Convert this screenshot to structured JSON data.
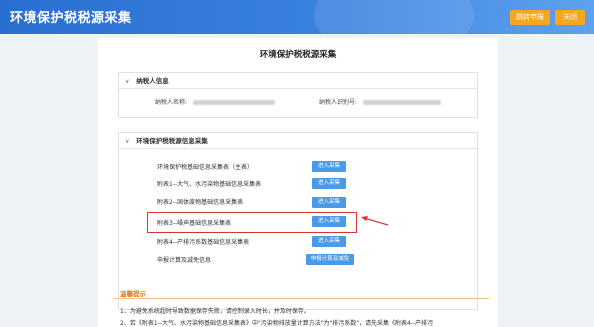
{
  "header": {
    "title": "环境保护税税源采集",
    "jump_button": "跳转申报",
    "close_button": "关闭"
  },
  "page_title": "环境保护税税源采集",
  "taxpayer_panel": {
    "title": "纳税人信息",
    "name_label": "纳税人名称:",
    "id_label": "纳税人识别号:"
  },
  "source_panel": {
    "title": "环境保护税税源信息采集",
    "rows": [
      {
        "label": "环境保护税基础信息采集表（主表）",
        "button": "进入采集"
      },
      {
        "label": "附表1--大气、水污染物基础信息采集表",
        "button": "进入采集"
      },
      {
        "label": "附表2--固体废物基础信息采集表",
        "button": "进入采集"
      },
      {
        "label": "附表3--噪声基础信息采集表",
        "button": "进入采集"
      },
      {
        "label": "附表4--产排污系数基础信息采集表",
        "button": "进入采集"
      },
      {
        "label": "申报计算及减免信息",
        "button": "申报计算及减免"
      }
    ]
  },
  "tips": {
    "title": "温馨提示",
    "items": [
      "1、为避免系统超时导致数据保存失败，请控制录入时长，并及时保存。",
      "2、若《附表1--大气、水污染物基础信息采集表》中\"污染物排放量计算方法\"为\"排污系数\"，请先采集《附表4--产排污"
    ]
  },
  "colors": {
    "header_blue": "#2a6fd0",
    "orange": "#f5a623",
    "button_blue": "#4a9ae8",
    "highlight_red": "#d9342b"
  }
}
